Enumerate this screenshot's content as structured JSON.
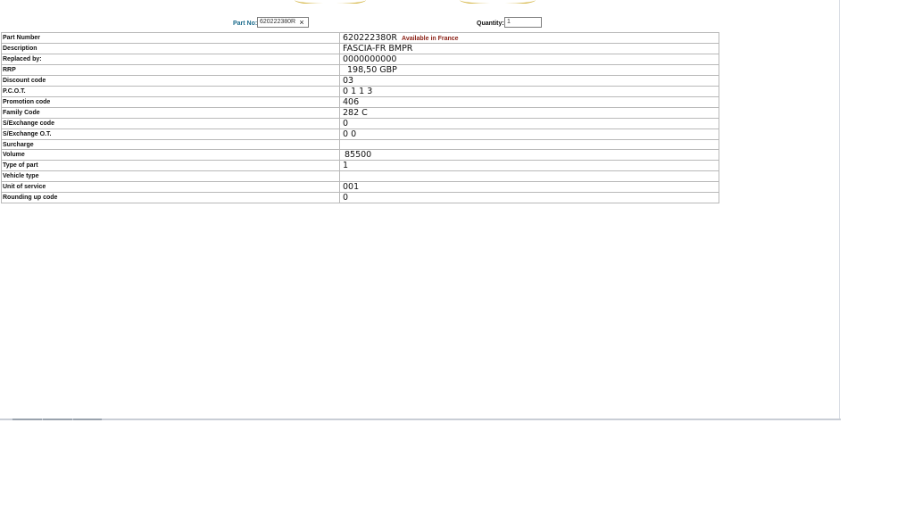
{
  "toolbar": {
    "part_no_label": "Part No:",
    "part_no_value": "620222380R",
    "clear_symbol": "×",
    "quantity_label": "Quantity:",
    "quantity_value": "1"
  },
  "details": {
    "rows": [
      {
        "label": "Part Number",
        "value": "620222380R",
        "note": "Available in France"
      },
      {
        "label": "Description",
        "value": "FASCIA-FR BMPR"
      },
      {
        "label": "Replaced by:",
        "value": "0000000000"
      },
      {
        "label": "RRP",
        "value": "198,50 GBP"
      },
      {
        "label": "Discount code",
        "value": "03"
      },
      {
        "label": "P.C.O.T.",
        "value": "0 1 1 3"
      },
      {
        "label": "Promotion code",
        "value": "406"
      },
      {
        "label": "Family Code",
        "value": "282 C"
      },
      {
        "label": "S/Exchange code",
        "value": "0"
      },
      {
        "label": "S/Exchange O.T.",
        "value": "0 0"
      },
      {
        "label": "Surcharge",
        "value": ""
      },
      {
        "label": "Volume",
        "value": "85500"
      },
      {
        "label": "Type of part",
        "value": "1"
      },
      {
        "label": "Vehicle type",
        "value": ""
      },
      {
        "label": "Unit of service",
        "value": "001"
      },
      {
        "label": "Rounding up code",
        "value": "0"
      }
    ]
  },
  "colors": {
    "accent_teal": "#1b6b8c",
    "availability_red": "#8a1f14",
    "decor_gold": "#d6b84a"
  }
}
